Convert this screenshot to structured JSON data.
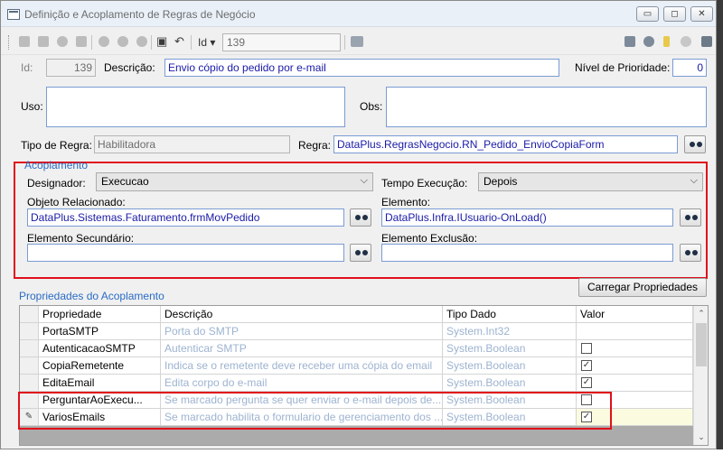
{
  "window": {
    "title": "Definição e Acoplamento de Regras de Negócio"
  },
  "titlebar_buttons": [
    {
      "icon": "minimize-icon",
      "glyph": "▭"
    },
    {
      "icon": "maximize-icon",
      "glyph": "◻"
    },
    {
      "icon": "close-icon",
      "glyph": "✕"
    }
  ],
  "toolbar": {
    "id_label": "Id",
    "id_value": "139"
  },
  "header": {
    "id_label": "Id:",
    "id_value": "139",
    "descricao_label": "Descrição:",
    "descricao_value": "Envio cópio do pedido por e-mail",
    "prioridade_label": "Nível de Prioridade:",
    "prioridade_value": "0",
    "uso_label": "Uso:",
    "uso_value": "",
    "obs_label": "Obs:",
    "obs_value": "",
    "tipo_label": "Tipo de Regra:",
    "tipo_value": "Habilitadora",
    "regra_label": "Regra:",
    "regra_value": "DataPlus.RegrasNegocio.RN_Pedido_EnvioCopiaForm"
  },
  "acoplamento": {
    "title": "Acoplamento",
    "designador_label": "Designador:",
    "designador_value": "Execucao",
    "tempo_label": "Tempo Execução:",
    "tempo_value": "Depois",
    "objeto_label": "Objeto Relacionado:",
    "objeto_value": "DataPlus.Sistemas.Faturamento.frmMovPedido",
    "elemento_label": "Elemento:",
    "elemento_value": "DataPlus.Infra.IUsuario-OnLoad()",
    "elem_sec_label": "Elemento Secundário:",
    "elem_sec_value": "",
    "elem_exc_label": "Elemento Exclusão:",
    "elem_exc_value": ""
  },
  "propriedades": {
    "title": "Propriedades do Acoplamento",
    "carregar_label": "Carregar Propriedades",
    "columns": [
      "Propriedade",
      "Descrição",
      "Tipo Dado",
      "Valor"
    ],
    "rows": [
      {
        "indicator": "",
        "prop": "PortaSMTP",
        "desc": "Porta do SMTP",
        "tipo": "System.Int32",
        "valor": "",
        "checkbox": false
      },
      {
        "indicator": "",
        "prop": "AutenticacaoSMTP",
        "desc": "Autenticar SMTP",
        "tipo": "System.Boolean",
        "valor": "",
        "checkbox": true
      },
      {
        "indicator": "",
        "prop": "CopiaRemetente",
        "desc": "Indica se o remetente deve receber uma cópia do email",
        "tipo": "System.Boolean",
        "valor": "✓",
        "checkbox": true
      },
      {
        "indicator": "",
        "prop": "EditaEmail",
        "desc": "Edita corpo do e-mail",
        "tipo": "System.Boolean",
        "valor": "✓",
        "checkbox": true
      },
      {
        "indicator": "",
        "prop": "PerguntarAoExecu...",
        "desc": "Se marcado pergunta se quer enviar o e-mail depois de...",
        "tipo": "System.Boolean",
        "valor": "",
        "checkbox": true
      },
      {
        "indicator": "✎",
        "prop": "VariosEmails",
        "desc": "Se marcado habilita o formulario de gerenciamento dos ...",
        "tipo": "System.Boolean",
        "valor": "✓",
        "checkbox": true
      }
    ]
  },
  "colors": {
    "accent_blue": "#2a6cc4",
    "highlight_red": "#e0101a",
    "value_text": "#1a1aa8"
  }
}
